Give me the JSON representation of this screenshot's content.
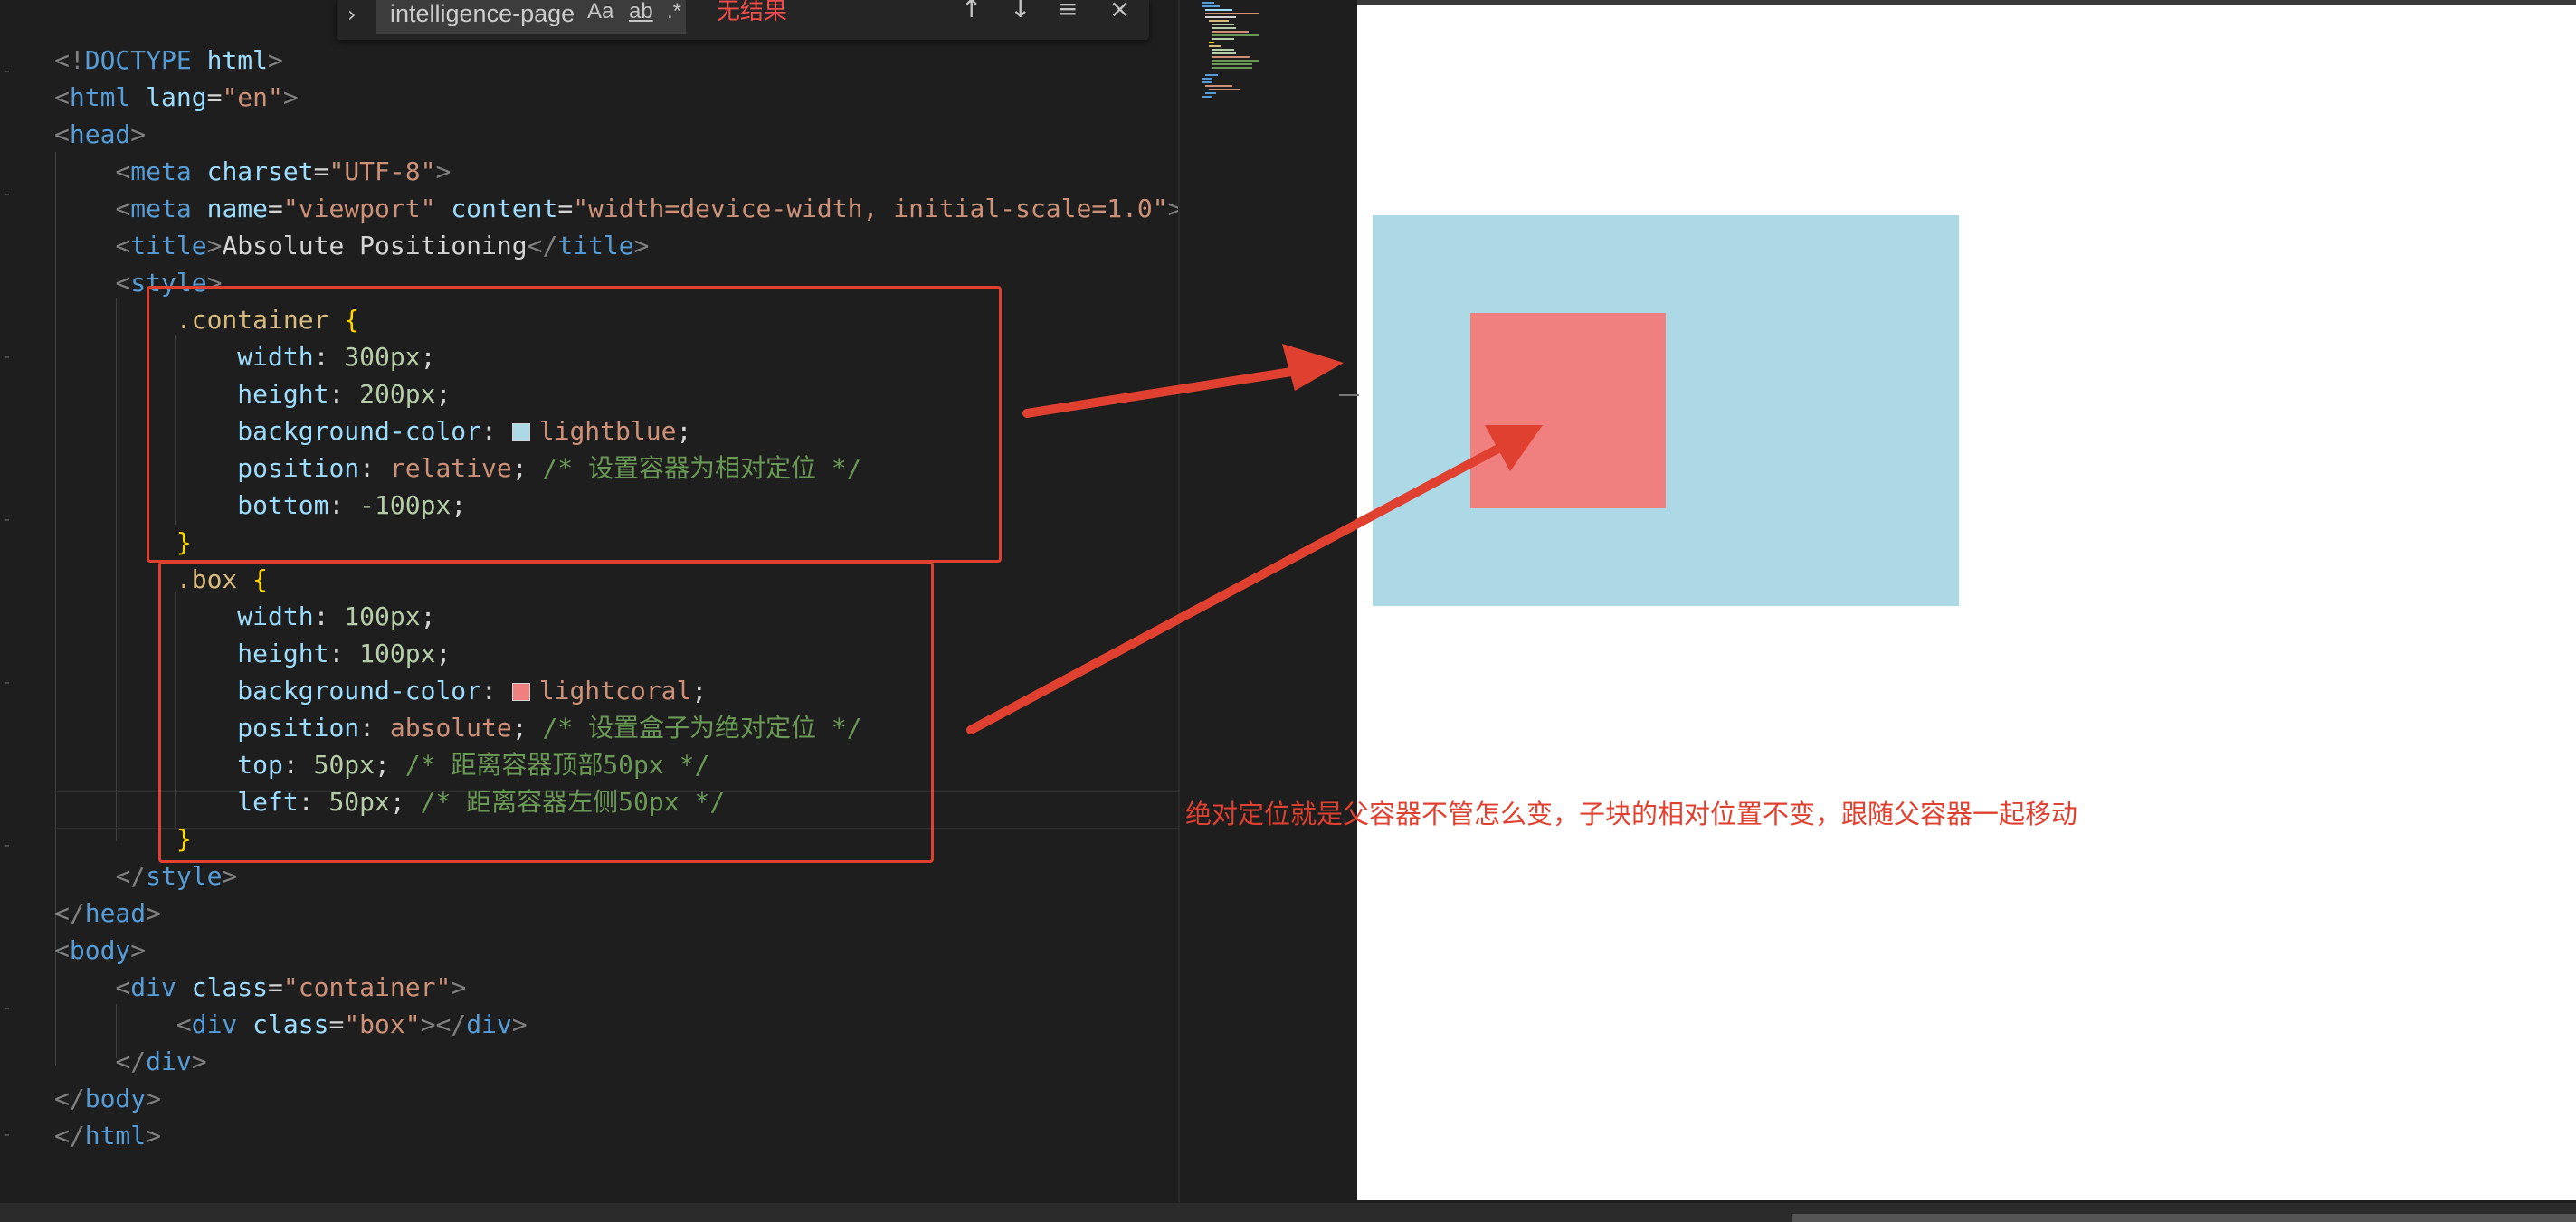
{
  "find": {
    "value": "intelligence-page",
    "match_case": "Aa",
    "whole_word": "ab",
    "regex": ".*",
    "result": "无结果"
  },
  "code": {
    "l1": {
      "a": "<!",
      "b": "DOCTYPE",
      "c": " html",
      "d": ">"
    },
    "l2": {
      "tag": "html",
      "attr": "lang",
      "val": "\"en\""
    },
    "l3": {
      "tag": "head"
    },
    "l4": {
      "tag": "meta",
      "attr": "charset",
      "val": "\"UTF-8\""
    },
    "l5": {
      "tag": "meta",
      "attr1": "name",
      "val1": "\"viewport\"",
      "attr2": "content",
      "val2": "\"width=device-width, initial-scale=1.0\""
    },
    "l6": {
      "tag": "title",
      "text": "Absolute Positioning",
      "close": "title"
    },
    "l7": {
      "tag": "style"
    },
    "l8": {
      "sel": ".container",
      "brace": "{"
    },
    "l9": {
      "prop": "width",
      "val": "300px"
    },
    "l10": {
      "prop": "height",
      "val": "200px"
    },
    "l11": {
      "prop": "background-color",
      "val": "lightblue"
    },
    "l12": {
      "prop": "position",
      "val": "relative",
      "comment": "/* 设置容器为相对定位 */"
    },
    "l13": {
      "prop": "bottom",
      "val": "-100px"
    },
    "l14": {
      "brace": "}"
    },
    "l15": {
      "sel": ".box",
      "brace": "{"
    },
    "l16": {
      "prop": "width",
      "val": "100px"
    },
    "l17": {
      "prop": "height",
      "val": "100px"
    },
    "l18": {
      "prop": "background-color",
      "val": "lightcoral"
    },
    "l19": {
      "prop": "position",
      "val": "absolute",
      "comment": "/* 设置盒子为绝对定位 */"
    },
    "l20": {
      "prop": "top",
      "val": "50px",
      "comment": "/* 距离容器顶部50px */"
    },
    "l21": {
      "prop": "left",
      "val": "50px",
      "comment": "/* 距离容器左侧50px */"
    },
    "l22": {
      "brace": "}"
    },
    "l23": {
      "tag": "style"
    },
    "l24": {
      "tag": "head"
    },
    "l25": {
      "tag": "body"
    },
    "l26": {
      "tag": "div",
      "attr": "class",
      "val": "\"container\""
    },
    "l27": {
      "tag": "div",
      "attr": "class",
      "val": "\"box\"",
      "close": "div"
    },
    "l28": {
      "tag": "div"
    },
    "l29": {
      "tag": "body"
    },
    "l30": {
      "tag": "html"
    }
  },
  "colors": {
    "lightblue": "#add8e6",
    "lightcoral": "#f08080",
    "annotation": "#e0402f"
  },
  "preview": {
    "annotation": "绝对定位就是父容器不管怎么变，子块的相对位置不变，跟随父容器一起移动"
  }
}
